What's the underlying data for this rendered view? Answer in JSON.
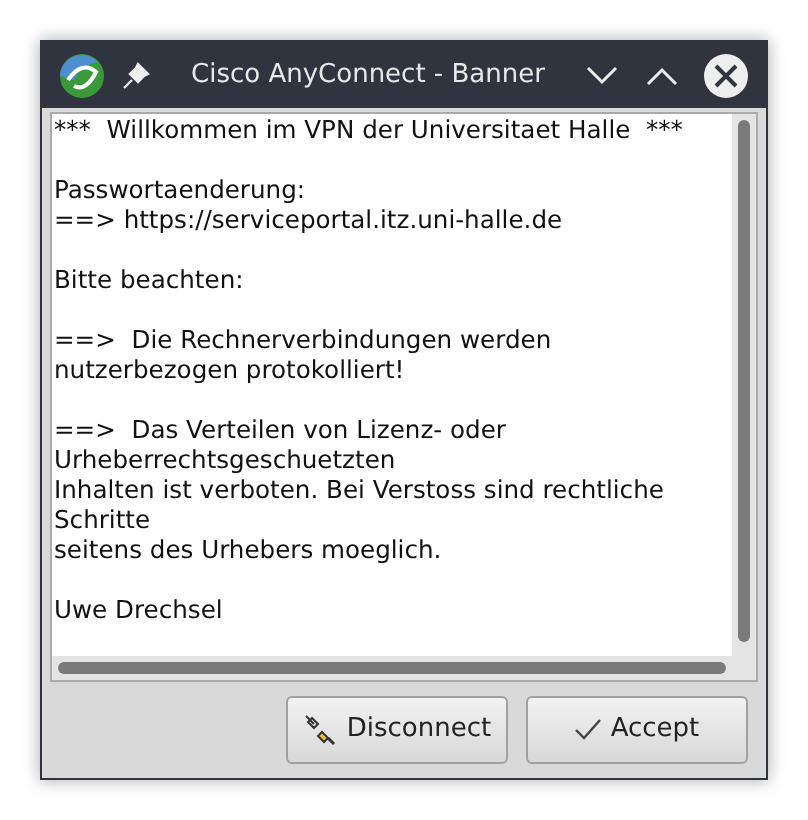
{
  "window": {
    "title": "Cisco AnyConnect - Banner"
  },
  "banner": {
    "paragraphs": [
      [
        "***  Willkommen im VPN der Universitaet Halle  ***"
      ],
      [
        "Passwortaenderung:",
        "==> https://serviceportal.itz.uni-halle.de"
      ],
      [
        "Bitte beachten:"
      ],
      [
        "==>  Die Rechnerverbindungen werden",
        "nutzerbezogen protokolliert!"
      ],
      [
        "==>  Das Verteilen von Lizenz- oder",
        "Urheberrechtsgeschuetzten",
        "Inhalten ist verboten. Bei Verstoss sind rechtliche",
        "Schritte",
        "seitens des Urhebers moeglich."
      ],
      [
        "Uwe Drechsel"
      ]
    ]
  },
  "buttons": [
    {
      "kind": "disconnect",
      "label": "Disconnect"
    },
    {
      "kind": "accept",
      "label": "Accept"
    }
  ]
}
